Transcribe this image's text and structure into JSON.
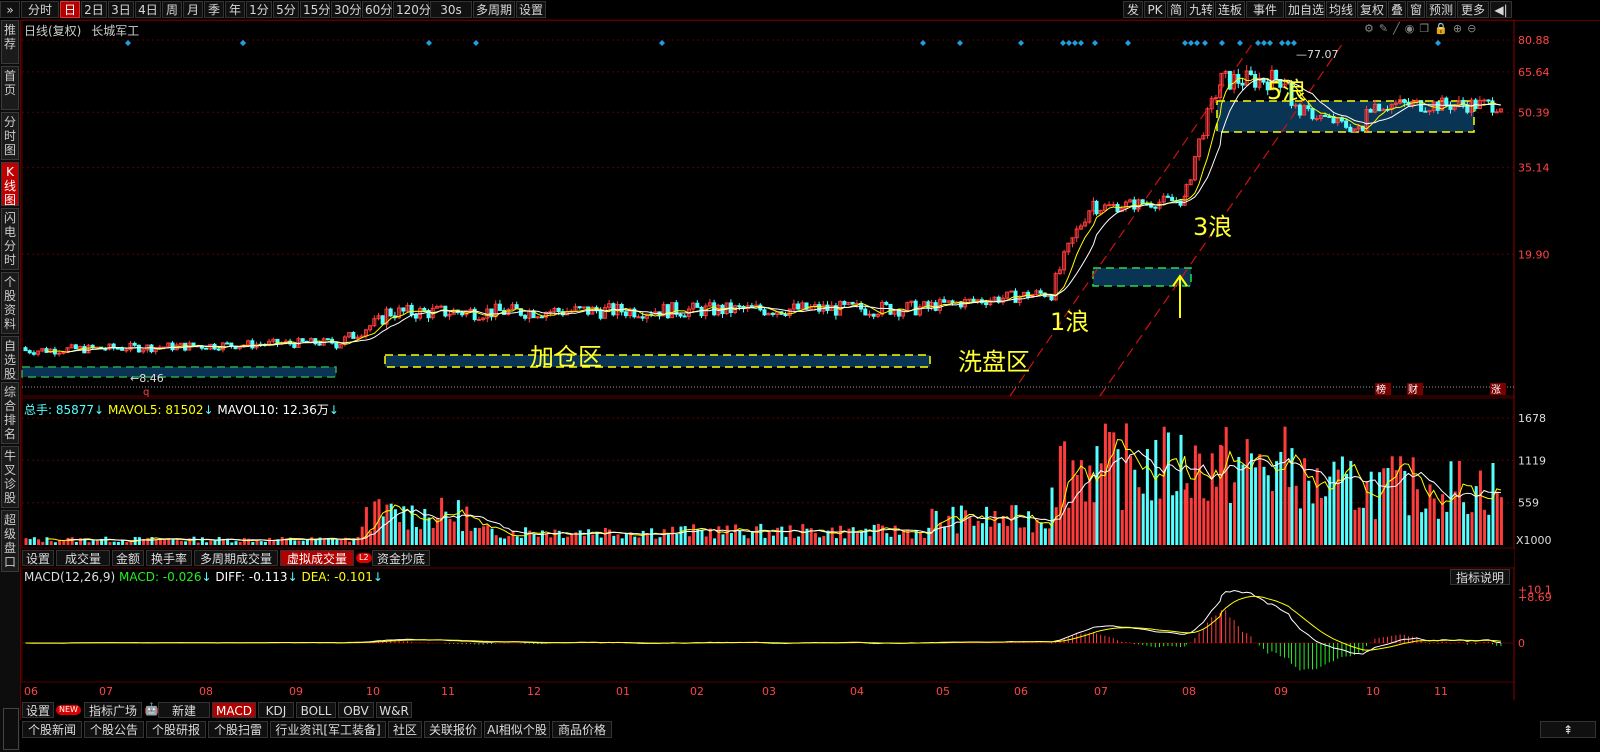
{
  "toolbar": {
    "left": [
      "分时",
      "日",
      "2日",
      "3日",
      "4日",
      "周",
      "月",
      "季",
      "年",
      "1分",
      "5分",
      "15分",
      "30分",
      "60分",
      "120分",
      "30s",
      "多周期",
      "设置"
    ],
    "active": "日",
    "right": [
      "发",
      "PK",
      "简",
      "九转",
      "连板",
      "事件",
      "加自选",
      "均线",
      "复权",
      "叠",
      "窗",
      "预测",
      "更多"
    ]
  },
  "sidebar": [
    "推荐",
    "首页",
    "分时图",
    "K线图",
    "闪电分时",
    "个股资料",
    "自选股",
    "综合排名",
    "牛叉诊股",
    "超级盘口"
  ],
  "sidebar_active": "K线图",
  "chart_header": {
    "mode": "日线(复权)",
    "stock": "长城军工"
  },
  "volume_header": {
    "total": "总手: 85877",
    "mavol5": "MAVOL5: 81502",
    "mavol10": "MAVOL10: 12.36万"
  },
  "macd_header": {
    "name": "MACD(12,26,9)",
    "macd": "MACD: -0.026",
    "diff": "DIFF: -0.113",
    "dea": "DEA: -0.101"
  },
  "indicator_explain": "指标说明",
  "volume_tabs": [
    "设置",
    "成交量",
    "金额",
    "换手率",
    "多周期成交量",
    "虚拟成交量",
    "资金抄底"
  ],
  "volume_tabs_active": "虚拟成交量",
  "l2_badge": "L2",
  "bottom_tabs": [
    "设置",
    "指标广场",
    "新建",
    "MACD",
    "KDJ",
    "BOLL",
    "OBV",
    "W&R"
  ],
  "bottom_tabs_active": "MACD",
  "new_badge": "NEW",
  "news_tabs": [
    "个股新闻",
    "个股公告",
    "个股研报",
    "个股扫雷",
    "行业资讯[军工装备]",
    "社区",
    "关联报价",
    "AI相似个股",
    "商品价格"
  ],
  "colors": {
    "up": "#ff3c3c",
    "down": "#54ffff",
    "ma_yellow": "#ffff00",
    "ma_white": "#ffffff",
    "box_fill": "#0c3d63",
    "dash": "#ffff00",
    "annot": "#ffff33",
    "diamond": "#1e9fe0",
    "grid": "#5a0000"
  },
  "annotations": {
    "jiacang": "加仓区",
    "xipan": "洗盘区",
    "wave1": "1浪",
    "wave3": "3浪",
    "wave5": "5浪",
    "low_label": "8.46",
    "high_label": "77.07",
    "q_mark": "q"
  },
  "bottom_marks": [
    "榜",
    "财",
    "涨"
  ],
  "chart_data": [
    {
      "type": "candlestick",
      "title": "长城军工 日线(复权)",
      "yscale": "log",
      "ylim": [
        8.46,
        80.88
      ],
      "y_ticks": [
        80.88,
        65.64,
        50.39,
        35.14,
        19.9
      ],
      "x_ticks": [
        "06",
        "07",
        "08",
        "09",
        "10",
        "11",
        "12",
        "01",
        "02",
        "03",
        "04",
        "05",
        "06",
        "07",
        "08",
        "09",
        "10",
        "11"
      ],
      "segments": [
        {
          "period": "06-09",
          "approx_price": [
            10.5,
            11.5
          ]
        },
        {
          "period": "10-04",
          "approx_price": [
            13.0,
            15.0
          ]
        },
        {
          "period": "05-06",
          "approx_price": [
            13.5,
            16.0
          ]
        },
        {
          "period": "07",
          "approx_price": [
            22.0,
            30.0
          ]
        },
        {
          "period": "08",
          "approx_price": [
            30.0,
            70.0
          ]
        },
        {
          "period": "08-09",
          "approx_price": [
            60.0,
            77.07
          ]
        },
        {
          "period": "09-11",
          "approx_price": [
            42.0,
            58.0
          ]
        }
      ],
      "high": 77.07,
      "low": 8.46
    },
    {
      "type": "bar",
      "title": "成交量",
      "y_ticks": [
        1678,
        1119,
        559
      ],
      "unit": "X1000",
      "series": [
        {
          "name": "MAVOL5",
          "last": 81502
        },
        {
          "name": "MAVOL10",
          "last": "12.36万"
        }
      ]
    },
    {
      "type": "line",
      "title": "MACD(12,26,9)",
      "y_ticks": [
        10.1,
        8.69,
        0
      ],
      "series": [
        {
          "name": "DIFF",
          "last": -0.113
        },
        {
          "name": "DEA",
          "last": -0.101
        },
        {
          "name": "MACD",
          "last": -0.026
        }
      ]
    }
  ]
}
